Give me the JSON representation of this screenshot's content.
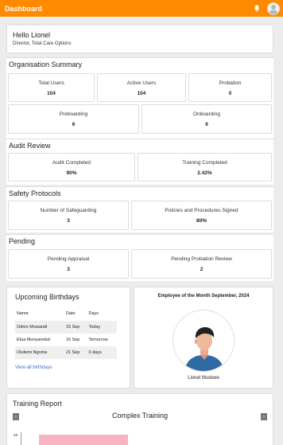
{
  "header": {
    "title": "Dashboard",
    "bg_color": "#ff8a00",
    "bell_icon": "bell-icon",
    "avatar_icon": "user-avatar-icon"
  },
  "greeting": {
    "hello": "Hello Lionel",
    "role": "Director, Total Care Options"
  },
  "org_summary": {
    "title": "Organisation Summary",
    "stats": [
      {
        "label": "Total Users",
        "value": "104"
      },
      {
        "label": "Active Users",
        "value": "104"
      },
      {
        "label": "Probation",
        "value": "0"
      },
      {
        "label": "Preboarding",
        "value": "6"
      },
      {
        "label": "Onboarding",
        "value": "6"
      }
    ]
  },
  "audit_review": {
    "title": "Audit Review",
    "stats": [
      {
        "label": "Audit Completed",
        "value": "90%"
      },
      {
        "label": "Training Completed",
        "value": "2.42%"
      }
    ]
  },
  "safety": {
    "title": "Safety Protocols",
    "stats": [
      {
        "label": "Number of Safeguarding",
        "value": "3"
      },
      {
        "label": "Policies and Procedures Signed",
        "value": "80%"
      }
    ]
  },
  "pending": {
    "title": "Pending",
    "stats": [
      {
        "label": "Pending Appraisal",
        "value": "3"
      },
      {
        "label": "Pending Probation Review",
        "value": "2"
      }
    ]
  },
  "birthdays": {
    "title": "Upcoming Birthdays",
    "columns": [
      "Name",
      "Date",
      "Days"
    ],
    "rows": [
      [
        "Odion Muwandi",
        "15 Sep",
        "Today"
      ],
      [
        "Efua Munyanebzi",
        "16 Sep",
        "Tomorrow"
      ],
      [
        "Olufemi Ngoma",
        "21 Sep",
        "6 days"
      ]
    ],
    "link": "View all birthdays"
  },
  "employee_of_month": {
    "title": "Employee of the Month September, 2024",
    "name": "Lionel Muskwe"
  },
  "training_report": {
    "title": "Training Report",
    "subtitle": "Complex Training",
    "prev_icon": "chevron-left-icon",
    "next_icon": "chevron-right-icon",
    "prev_glyph": "‹",
    "next_glyph": "›",
    "y_tick": "15",
    "bar_color": "#f7b3c2"
  }
}
